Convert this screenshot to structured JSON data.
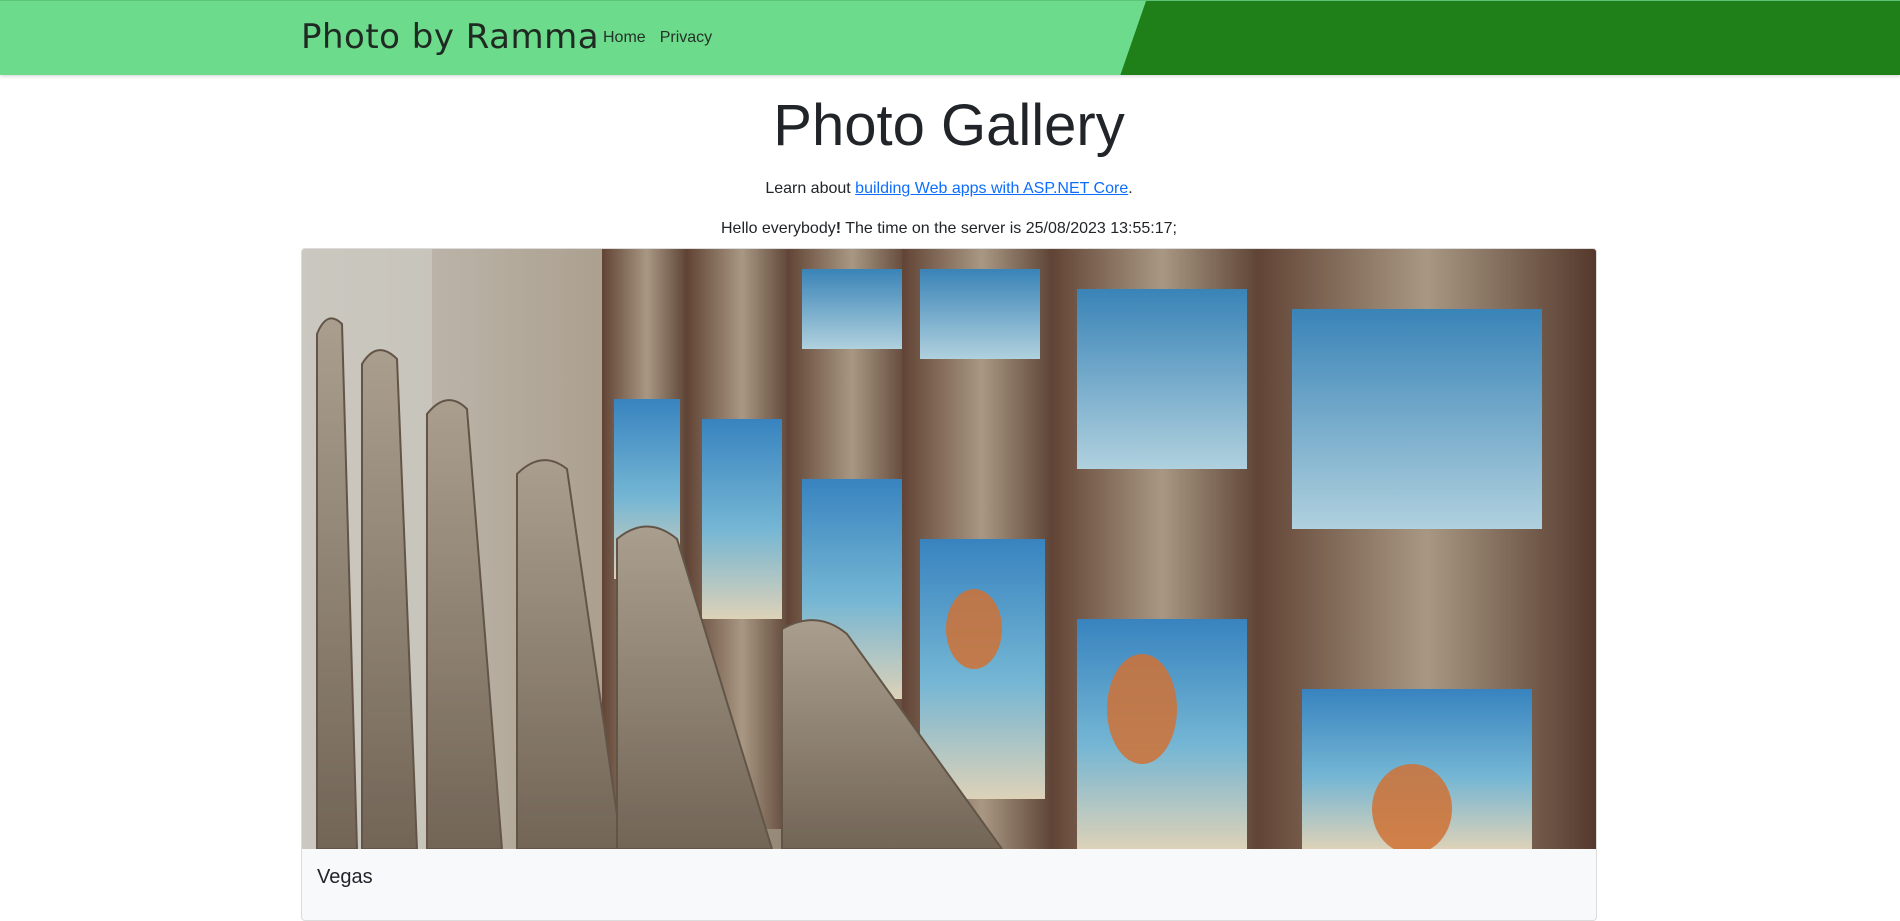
{
  "navbar": {
    "brand": "Photo by Ramma",
    "links": [
      {
        "label": "Home"
      },
      {
        "label": "Privacy"
      }
    ],
    "colors": {
      "bar": "#6cdb8b",
      "accent": "#1f801a"
    }
  },
  "main": {
    "title": "Photo Gallery",
    "lead_prefix": "Learn about ",
    "lead_link": "building Web apps with ASP.NET Core",
    "lead_suffix": ".",
    "greeting": "Hello everybody",
    "greeting_mark": "!",
    "server_text": " The time on the server is 25/08/2023 13:55:17;"
  },
  "gallery": {
    "cards": [
      {
        "caption": "Vegas",
        "image": "slot-machines-photo"
      }
    ]
  }
}
